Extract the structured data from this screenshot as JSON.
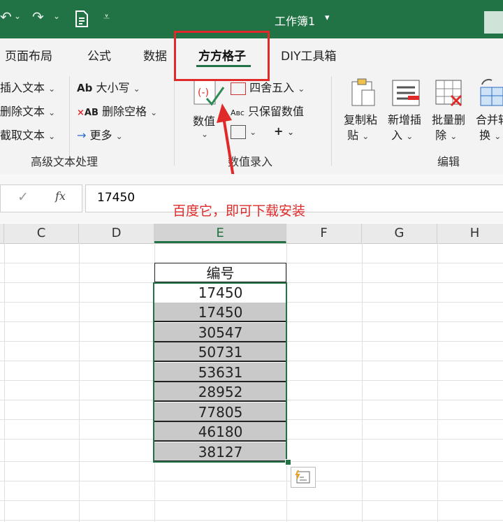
{
  "colors": {
    "accent": "#217346",
    "annotation": "#e02a2a",
    "selection_fill": "#c9c9c9"
  },
  "titlebar": {
    "title": "工作簿1",
    "title_chevron": "▾",
    "undo_icon": "undo-icon",
    "redo_icon": "redo-icon",
    "customize_icon": "customize-qat-icon"
  },
  "tabs": [
    {
      "label": "页面布局"
    },
    {
      "label": "公式"
    },
    {
      "label": "数据"
    },
    {
      "label": "方方格子"
    },
    {
      "label": "DIY工具箱"
    }
  ],
  "ribbon": {
    "text_group": {
      "items": [
        "插入文本",
        "删除文本",
        "截取文本"
      ],
      "case_label": "大小写",
      "trim_label": "删除空格",
      "more_label": "更多",
      "group_label": "高级文本处理"
    },
    "number_group": {
      "numeric_label": "数值",
      "round_label": "四舍五入",
      "keep_numeric_label": "只保留数值",
      "plus_label": "+",
      "group_label": "数值录入"
    },
    "edit_group": {
      "copy_paste": [
        "复制粘",
        "贴"
      ],
      "new_insert": [
        "新增插",
        "入"
      ],
      "batch_delete": [
        "批量删",
        "除"
      ],
      "merge": [
        "合并转",
        "换"
      ],
      "group_label": "编辑"
    }
  },
  "formula_bar": {
    "cancel_icon": "cancel-icon",
    "check_icon": "check-icon",
    "fx_label": "fx",
    "value": "17450"
  },
  "annotation_text": "百度它，即可下载安装",
  "columns": [
    "C",
    "D",
    "E",
    "F",
    "G",
    "H"
  ],
  "selected_column": "E",
  "table": {
    "header": "编号",
    "values": [
      "17450",
      "17450",
      "30547",
      "50731",
      "53631",
      "28952",
      "77805",
      "46180",
      "38127"
    ]
  }
}
